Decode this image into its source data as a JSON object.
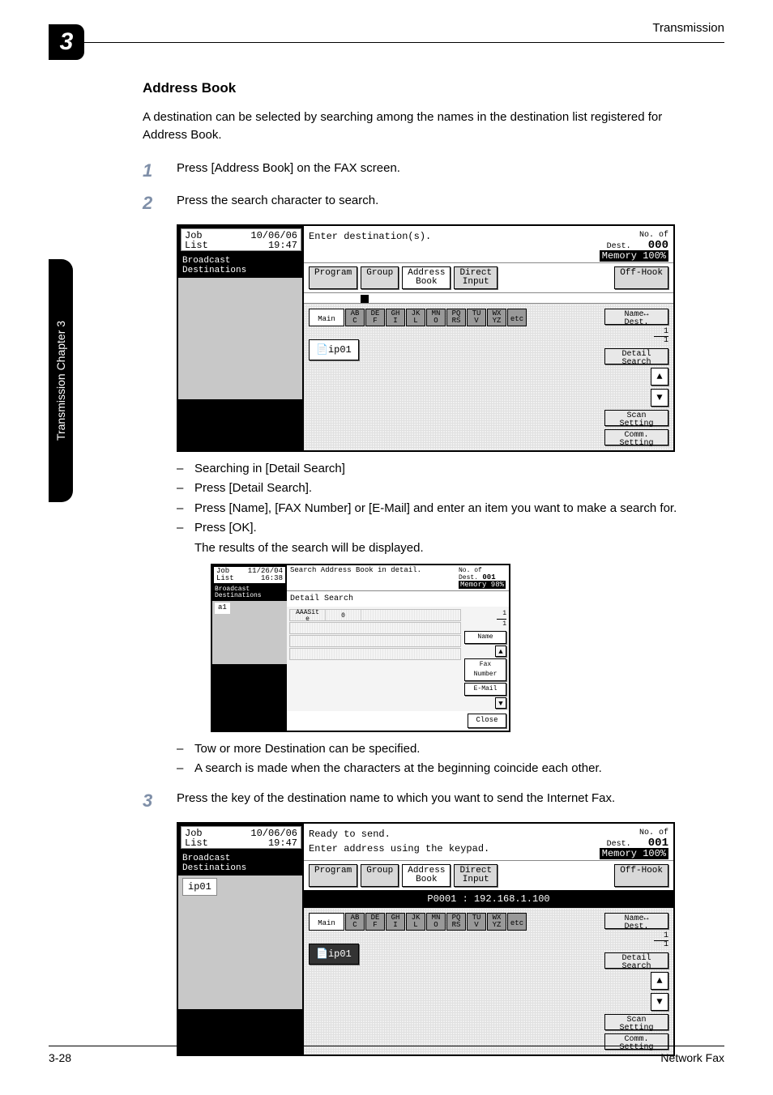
{
  "header": {
    "chapter_num": "3",
    "section": "Transmission"
  },
  "sidetab": {
    "label": "Transmission     Chapter 3"
  },
  "content": {
    "heading": "Address Book",
    "intro": "A destination can be selected by searching among the names in the destination list registered for Address Book.",
    "step1": {
      "num": "1",
      "text": "Press [Address Book] on the FAX screen."
    },
    "step2": {
      "num": "2",
      "text": "Press the search character to search."
    },
    "sub1": "Searching in [Detail Search]",
    "sub2": "Press [Detail Search].",
    "sub3": "Press [Name], [FAX Number] or [E-Mail] and enter an item you want to make a search for.",
    "sub4": "Press [OK].",
    "sub4_note": "The results of the search will be displayed.",
    "sub5": "Tow or more Destination can be specified.",
    "sub6": "A search is made when the characters at the beginning coincide each other.",
    "step3": {
      "num": "3",
      "text": "Press the key of the destination name to which you want to send the Internet Fax."
    }
  },
  "screen1": {
    "job_label": "Job\nList",
    "job_date": "10/06/06\n19:47",
    "bcast": "Broadcast\nDestinations",
    "prompt": "Enter destination(s).",
    "no_dest_label": "No. of\nDest.",
    "no_dest_val": "000",
    "memory": "Memory 100%",
    "btn_program": "Program",
    "btn_group": "Group",
    "btn_address": "Address\nBook",
    "btn_direct": "Direct\nInput",
    "btn_offhook": "Off-Hook",
    "tab_main": "Main",
    "tabs": [
      "AB\nC",
      "DE\nF",
      "GH\nI",
      "JK\nL",
      "MN\nO",
      "PQ\nRS",
      "TU\nV",
      "WX\nYZ",
      "etc"
    ],
    "entry_ip": "ip01",
    "side_name": "Name↔\nDest.",
    "side_detail": "Detail\nSearch",
    "side_scan": "Scan\nSetting",
    "side_comm": "Comm.\nSetting",
    "frac_top": "1",
    "frac_bot": "1"
  },
  "detail_screen": {
    "job_label": "Job\nList",
    "job_date": "11/26/04\n16:38",
    "bcast": "Broadcast\nDestinations",
    "a1": "a1",
    "prompt": "Search Address Book in detail.",
    "no_dest_label": "No. of\nDest.",
    "no_dest_val": "001",
    "memory": "Memory  98%",
    "title": "Detail Search",
    "cell1": "AAASit\ne",
    "cell2": "0",
    "side_name": "Name",
    "side_fax": "Fax\nNumber",
    "side_email": "E-Mail",
    "frac_top": "1",
    "frac_bot": "1",
    "close": "Close"
  },
  "screen2": {
    "job_label": "Job\nList",
    "job_date": "10/06/06\n19:47",
    "bcast": "Broadcast\nDestinations",
    "dest_ip": "ip01",
    "prompt1": "Ready to send.",
    "prompt2": "Enter address using the keypad.",
    "no_dest_label": "No. of\nDest.",
    "no_dest_val": "001",
    "memory": "Memory 100%",
    "btn_program": "Program",
    "btn_group": "Group",
    "btn_address": "Address\nBook",
    "btn_direct": "Direct\nInput",
    "btn_offhook": "Off-Hook",
    "ip_row": "P0001 : 192.168.1.100",
    "tab_main": "Main",
    "tabs": [
      "AB\nC",
      "DE\nF",
      "GH\nI",
      "JK\nL",
      "MN\nO",
      "PQ\nRS",
      "TU\nV",
      "WX\nYZ",
      "etc"
    ],
    "entry_ip": "ip01",
    "side_name": "Name↔\nDest.",
    "side_detail": "Detail\nSearch",
    "side_scan": "Scan\nSetting",
    "side_comm": "Comm.\nSetting",
    "frac_top": "1",
    "frac_bot": "1"
  },
  "footer": {
    "pagenum": "3-28",
    "title": "Network Fax"
  }
}
